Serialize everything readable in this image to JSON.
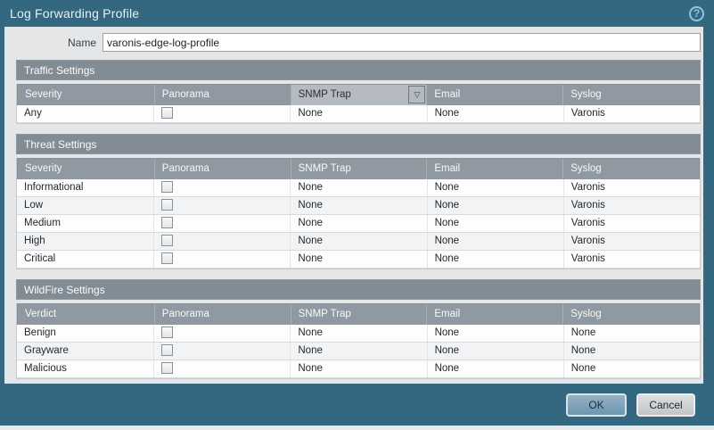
{
  "dialog": {
    "title": "Log Forwarding Profile"
  },
  "icons": {
    "help": "?",
    "column_menu": "▽"
  },
  "name_field": {
    "label": "Name",
    "value": "varonis-edge-log-profile"
  },
  "sections": [
    {
      "title": "Traffic Settings",
      "columns": [
        "Severity",
        "Panorama",
        "SNMP Trap",
        "Email",
        "Syslog"
      ],
      "highlighted_column": 2,
      "rows": [
        {
          "label": "Any",
          "panorama": false,
          "snmp_trap": "None",
          "email": "None",
          "syslog": "Varonis"
        }
      ]
    },
    {
      "title": "Threat Settings",
      "columns": [
        "Severity",
        "Panorama",
        "SNMP Trap",
        "Email",
        "Syslog"
      ],
      "highlighted_column": null,
      "rows": [
        {
          "label": "Informational",
          "panorama": false,
          "snmp_trap": "None",
          "email": "None",
          "syslog": "Varonis"
        },
        {
          "label": "Low",
          "panorama": false,
          "snmp_trap": "None",
          "email": "None",
          "syslog": "Varonis"
        },
        {
          "label": "Medium",
          "panorama": false,
          "snmp_trap": "None",
          "email": "None",
          "syslog": "Varonis"
        },
        {
          "label": "High",
          "panorama": false,
          "snmp_trap": "None",
          "email": "None",
          "syslog": "Varonis"
        },
        {
          "label": "Critical",
          "panorama": false,
          "snmp_trap": "None",
          "email": "None",
          "syslog": "Varonis"
        }
      ]
    },
    {
      "title": "WildFire Settings",
      "columns": [
        "Verdict",
        "Panorama",
        "SNMP Trap",
        "Email",
        "Syslog"
      ],
      "highlighted_column": null,
      "rows": [
        {
          "label": "Benign",
          "panorama": false,
          "snmp_trap": "None",
          "email": "None",
          "syslog": "None"
        },
        {
          "label": "Grayware",
          "panorama": false,
          "snmp_trap": "None",
          "email": "None",
          "syslog": "None"
        },
        {
          "label": "Malicious",
          "panorama": false,
          "snmp_trap": "None",
          "email": "None",
          "syslog": "None"
        }
      ]
    }
  ],
  "footer": {
    "ok_label": "OK",
    "cancel_label": "Cancel"
  },
  "colors": {
    "chrome": "#336880",
    "body_bg": "#e4e6e8",
    "section_bar": "#828c95",
    "column_header": "#9099a1",
    "active_column_header": "#b5bac0",
    "row_alt": "#f1f3f4",
    "ok_button": "#7ba0b9",
    "cancel_button": "#cdd0d3",
    "help_icon": "#8fc4dd"
  }
}
